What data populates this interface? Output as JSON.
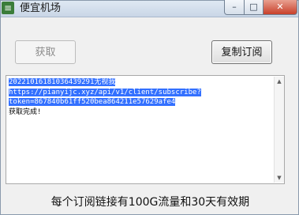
{
  "window": {
    "title": "便宜机场",
    "icon": "app-logo-icon",
    "controls": {
      "minimize": "–",
      "maximize": "□",
      "close": "✕"
    }
  },
  "toolbar": {
    "fetch_label": "获取",
    "copy_label": "复制订阅"
  },
  "log": {
    "line1": "20221016181036439291无视我",
    "line2": "https://pianyijc.xyz/api/v1/client/subscribe?",
    "line3": "token=867840b61ff520bea864211e57629afe4",
    "line4": "获取完成!"
  },
  "footer": {
    "note": "每个订阅链接有100G流量和30天有效期"
  }
}
